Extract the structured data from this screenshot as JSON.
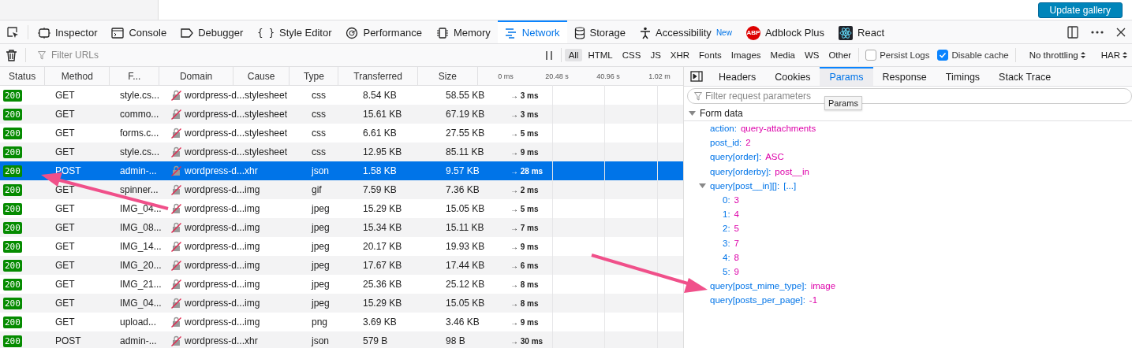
{
  "page_button": {
    "label": "Update gallery"
  },
  "tools": [
    {
      "kind": "inspector",
      "label": "Inspector",
      "selected": false
    },
    {
      "kind": "console",
      "label": "Console",
      "selected": false
    },
    {
      "kind": "debugger",
      "label": "Debugger",
      "selected": false
    },
    {
      "kind": "style",
      "label": "Style Editor",
      "icon_text": "{ }",
      "selected": false
    },
    {
      "kind": "performance",
      "label": "Performance",
      "selected": false
    },
    {
      "kind": "memory",
      "label": "Memory",
      "selected": false
    },
    {
      "kind": "network",
      "label": "Network",
      "selected": true
    },
    {
      "kind": "storage",
      "label": "Storage",
      "selected": false
    },
    {
      "kind": "accessibility",
      "label": "Accessibility",
      "badge": "New",
      "selected": false
    },
    {
      "kind": "adblock",
      "label": "Adblock Plus",
      "icon_text": "ABP",
      "selected": false
    },
    {
      "kind": "react",
      "label": "React",
      "selected": false
    }
  ],
  "filter_bar": {
    "placeholder": "Filter URLs",
    "types": [
      {
        "label": "All",
        "selected": true
      },
      {
        "label": "HTML",
        "selected": false
      },
      {
        "label": "CSS",
        "selected": false
      },
      {
        "label": "JS",
        "selected": false
      },
      {
        "label": "XHR",
        "selected": false
      },
      {
        "label": "Fonts",
        "selected": false
      },
      {
        "label": "Images",
        "selected": false
      },
      {
        "label": "Media",
        "selected": false
      },
      {
        "label": "WS",
        "selected": false
      },
      {
        "label": "Other",
        "selected": false
      }
    ],
    "options": [
      {
        "label": "Persist Logs",
        "checked": false
      },
      {
        "label": "Disable cache",
        "checked": true
      }
    ],
    "menus": [
      {
        "label": "No throttling"
      },
      {
        "label": "HAR"
      }
    ]
  },
  "table": {
    "columns": [
      "Status",
      "Method",
      "F...",
      "Domain",
      "Cause",
      "Type",
      "Transferred",
      "Size"
    ],
    "timeline": [
      "0 ms",
      "20.48 s",
      "40.96 s",
      "1.02 m"
    ],
    "rows": [
      {
        "status": "200",
        "method": "GET",
        "file": "style.cs...",
        "domain": "wordpress-d...",
        "cause": "stylesheet",
        "type": "css",
        "transferred": "8.54 KB",
        "size": "58.55 KB",
        "timing": "→ 3 ms",
        "selected": false
      },
      {
        "status": "200",
        "method": "GET",
        "file": "commo...",
        "domain": "wordpress-d...",
        "cause": "stylesheet",
        "type": "css",
        "transferred": "15.61 KB",
        "size": "67.19 KB",
        "timing": "→ 3 ms",
        "selected": false
      },
      {
        "status": "200",
        "method": "GET",
        "file": "forms.c...",
        "domain": "wordpress-d...",
        "cause": "stylesheet",
        "type": "css",
        "transferred": "6.61 KB",
        "size": "27.55 KB",
        "timing": "→ 5 ms",
        "selected": false
      },
      {
        "status": "200",
        "method": "GET",
        "file": "style.cs...",
        "domain": "wordpress-d...",
        "cause": "stylesheet",
        "type": "css",
        "transferred": "12.95 KB",
        "size": "85.11 KB",
        "timing": "→ 9 ms",
        "selected": false
      },
      {
        "status": "200",
        "method": "POST",
        "file": "admin-...",
        "domain": "wordpress-d...",
        "cause": "xhr",
        "type": "json",
        "transferred": "1.58 KB",
        "size": "9.57 KB",
        "timing": "→ 28 ms",
        "selected": true
      },
      {
        "status": "200",
        "method": "GET",
        "file": "spinner...",
        "domain": "wordpress-d...",
        "cause": "img",
        "type": "gif",
        "transferred": "7.59 KB",
        "size": "7.36 KB",
        "timing": "→ 2 ms",
        "selected": false
      },
      {
        "status": "200",
        "method": "GET",
        "file": "IMG_04...",
        "domain": "wordpress-d...",
        "cause": "img",
        "type": "jpeg",
        "transferred": "15.29 KB",
        "size": "15.05 KB",
        "timing": "→ 5 ms",
        "selected": false
      },
      {
        "status": "200",
        "method": "GET",
        "file": "IMG_08...",
        "domain": "wordpress-d...",
        "cause": "img",
        "type": "jpeg",
        "transferred": "15.34 KB",
        "size": "15.11 KB",
        "timing": "→ 7 ms",
        "selected": false
      },
      {
        "status": "200",
        "method": "GET",
        "file": "IMG_14...",
        "domain": "wordpress-d...",
        "cause": "img",
        "type": "jpeg",
        "transferred": "20.17 KB",
        "size": "19.93 KB",
        "timing": "→ 9 ms",
        "selected": false
      },
      {
        "status": "200",
        "method": "GET",
        "file": "IMG_20...",
        "domain": "wordpress-d...",
        "cause": "img",
        "type": "jpeg",
        "transferred": "17.67 KB",
        "size": "17.44 KB",
        "timing": "→ 6 ms",
        "selected": false
      },
      {
        "status": "200",
        "method": "GET",
        "file": "IMG_21...",
        "domain": "wordpress-d...",
        "cause": "img",
        "type": "jpeg",
        "transferred": "25.36 KB",
        "size": "25.12 KB",
        "timing": "→ 8 ms",
        "selected": false
      },
      {
        "status": "200",
        "method": "GET",
        "file": "IMG_04...",
        "domain": "wordpress-d...",
        "cause": "img",
        "type": "jpeg",
        "transferred": "15.29 KB",
        "size": "15.05 KB",
        "timing": "→ 8 ms",
        "selected": false
      },
      {
        "status": "200",
        "method": "GET",
        "file": "upload...",
        "domain": "wordpress-d...",
        "cause": "img",
        "type": "png",
        "transferred": "3.69 KB",
        "size": "3.46 KB",
        "timing": "→ 9 ms",
        "selected": false
      },
      {
        "status": "200",
        "method": "POST",
        "file": "admin-...",
        "domain": "wordpress-d...",
        "cause": "xhr",
        "type": "json",
        "transferred": "579 B",
        "size": "98 B",
        "timing": "→ 30 ms",
        "selected": false
      }
    ]
  },
  "details": {
    "tabs": [
      {
        "label": "Headers",
        "selected": false
      },
      {
        "label": "Cookies",
        "selected": false
      },
      {
        "label": "Params",
        "selected": true
      },
      {
        "label": "Response",
        "selected": false
      },
      {
        "label": "Timings",
        "selected": false
      },
      {
        "label": "Stack Trace",
        "selected": false
      }
    ],
    "placeholder": "Filter request parameters",
    "tooltip": "Params",
    "section": {
      "title": "Form data",
      "expanded": true
    },
    "params": [
      {
        "name": "action:",
        "value": "query-attachments"
      },
      {
        "name": "post_id:",
        "value": "2"
      },
      {
        "name": "query[order]:",
        "value": "ASC"
      },
      {
        "name": "query[orderby]:",
        "value": "post__in"
      },
      {
        "name": "query[post__in][]:",
        "value": "[...]",
        "expanded": true,
        "children": [
          {
            "name": "0:",
            "value": "3"
          },
          {
            "name": "1:",
            "value": "4"
          },
          {
            "name": "2:",
            "value": "5"
          },
          {
            "name": "3:",
            "value": "7"
          },
          {
            "name": "4:",
            "value": "8"
          },
          {
            "name": "5:",
            "value": "9"
          }
        ]
      },
      {
        "name": "query[post_mime_type]:",
        "value": "image"
      },
      {
        "name": "query[posts_per_page]:",
        "value": "-1"
      }
    ]
  }
}
